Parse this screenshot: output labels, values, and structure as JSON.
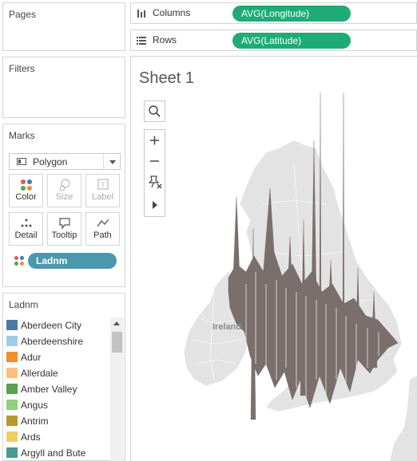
{
  "pages": {
    "title": "Pages"
  },
  "filters": {
    "title": "Filters"
  },
  "marks": {
    "title": "Marks",
    "mark_type": "Polygon",
    "buttons": [
      {
        "label": "Color",
        "enabled": true,
        "icon": "color-icon"
      },
      {
        "label": "Size",
        "enabled": false,
        "icon": "size-icon"
      },
      {
        "label": "Label",
        "enabled": false,
        "icon": "label-icon"
      },
      {
        "label": "Detail",
        "enabled": true,
        "icon": "detail-icon"
      },
      {
        "label": "Tooltip",
        "enabled": true,
        "icon": "tooltip-icon"
      },
      {
        "label": "Path",
        "enabled": true,
        "icon": "path-icon"
      }
    ],
    "pill": "Ladnm"
  },
  "legend": {
    "title": "Ladnm",
    "items": [
      {
        "label": "Aberdeen City",
        "color": "#4e79a7"
      },
      {
        "label": "Aberdeenshire",
        "color": "#a0cbe8"
      },
      {
        "label": "Adur",
        "color": "#f28e2b"
      },
      {
        "label": "Allerdale",
        "color": "#ffbe7d"
      },
      {
        "label": "Amber Valley",
        "color": "#59a14f"
      },
      {
        "label": "Angus",
        "color": "#8cd17d"
      },
      {
        "label": "Antrim",
        "color": "#b6992d"
      },
      {
        "label": "Ards",
        "color": "#f1ce63"
      },
      {
        "label": "Argyll and Bute",
        "color": "#499894"
      }
    ]
  },
  "shelves": {
    "columns": {
      "label": "Columns",
      "pill": "AVG(Longitude)"
    },
    "rows": {
      "label": "Rows",
      "pill": "AVG(Latitude)"
    }
  },
  "sheet": {
    "title": "Sheet 1",
    "map_label": "Ireland"
  },
  "colors": {
    "shelf_pill": "#1fab77",
    "dimension_pill": "#4c97ab",
    "polygon": "#7b6f6e"
  }
}
